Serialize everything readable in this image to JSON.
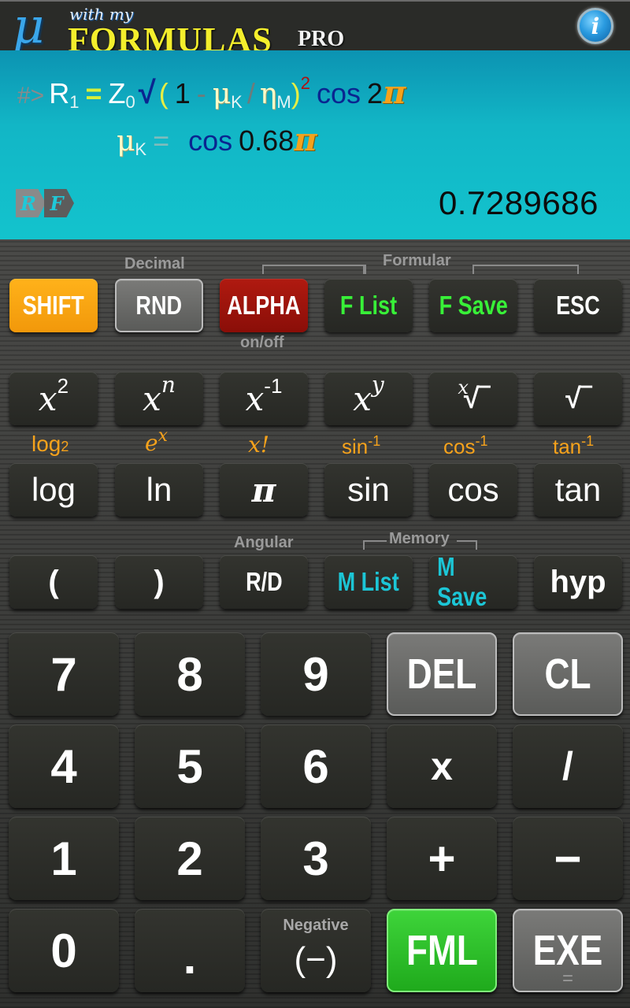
{
  "header": {
    "logo_mu": "μ",
    "logo_with": "with my",
    "logo_formulas": "FORMULAS",
    "logo_pro": "PRO",
    "info_icon": "i"
  },
  "display": {
    "prompt": "#>",
    "line1": {
      "lhs_var": "R",
      "lhs_sub": "1",
      "equals": "=",
      "z_var": "Z",
      "z_sub": "0",
      "sqrt": "√",
      "open_paren": "(",
      "one": "1",
      "minus": "-",
      "mu": "μ",
      "mu_sub": "K",
      "slash": "/",
      "eta": "η",
      "eta_sub": "M",
      "close_paren": ")",
      "exponent": "2",
      "cos": "cos",
      "coef": "2",
      "pi": "π"
    },
    "line2": {
      "mu": "μ",
      "mu_sub": "K",
      "equals": "=",
      "cos": "cos",
      "value": "0.68",
      "pi": "π"
    },
    "mode_icon": {
      "r": "R",
      "f": "F"
    },
    "result": "0.7289686"
  },
  "labels": {
    "decimal": "Decimal",
    "formular": "Formular",
    "on_off": "on/off",
    "angular": "Angular",
    "memory": "Memory",
    "negative": "Negative"
  },
  "row1": {
    "shift": "SHIFT",
    "rnd": "RND",
    "alpha": "ALPHA",
    "f_list": "F List",
    "f_save": "F Save",
    "esc": "ESC"
  },
  "row2": {
    "x2_base": "x",
    "x2_sup": "2",
    "xn_base": "x",
    "xn_sup": "n",
    "xinv_base": "x",
    "xinv_sup": "-1",
    "xy_base": "x",
    "xy_sup": "y",
    "xroot_idx": "x",
    "xroot_sym": "√‾",
    "sqrt_sym": "√‾"
  },
  "shift_labels": {
    "log2": "log",
    "log2_sub": "2",
    "ex_base": "e",
    "ex_sup": "x",
    "fact": "x!",
    "asin": "sin",
    "acos": "cos",
    "atan": "tan",
    "inv_sup": "-1"
  },
  "row3": {
    "log": "log",
    "ln": "ln",
    "pi": "π",
    "sin": "sin",
    "cos": "cos",
    "tan": "tan"
  },
  "row4": {
    "open_paren": "(",
    "close_paren": ")",
    "rd": "R/D",
    "m_list": "M List",
    "m_save": "M Save",
    "hyp": "hyp"
  },
  "numpad": {
    "seven": "7",
    "eight": "8",
    "nine": "9",
    "del": "DEL",
    "cl": "CL",
    "four": "4",
    "five": "5",
    "six": "6",
    "multiply": "x",
    "divide": "/",
    "one": "1",
    "two": "2",
    "three": "3",
    "plus": "+",
    "minus": "−",
    "zero": "0",
    "dot": ".",
    "neg": "(−)",
    "fml": "FML",
    "exe": "EXE",
    "exe_sub": "="
  }
}
